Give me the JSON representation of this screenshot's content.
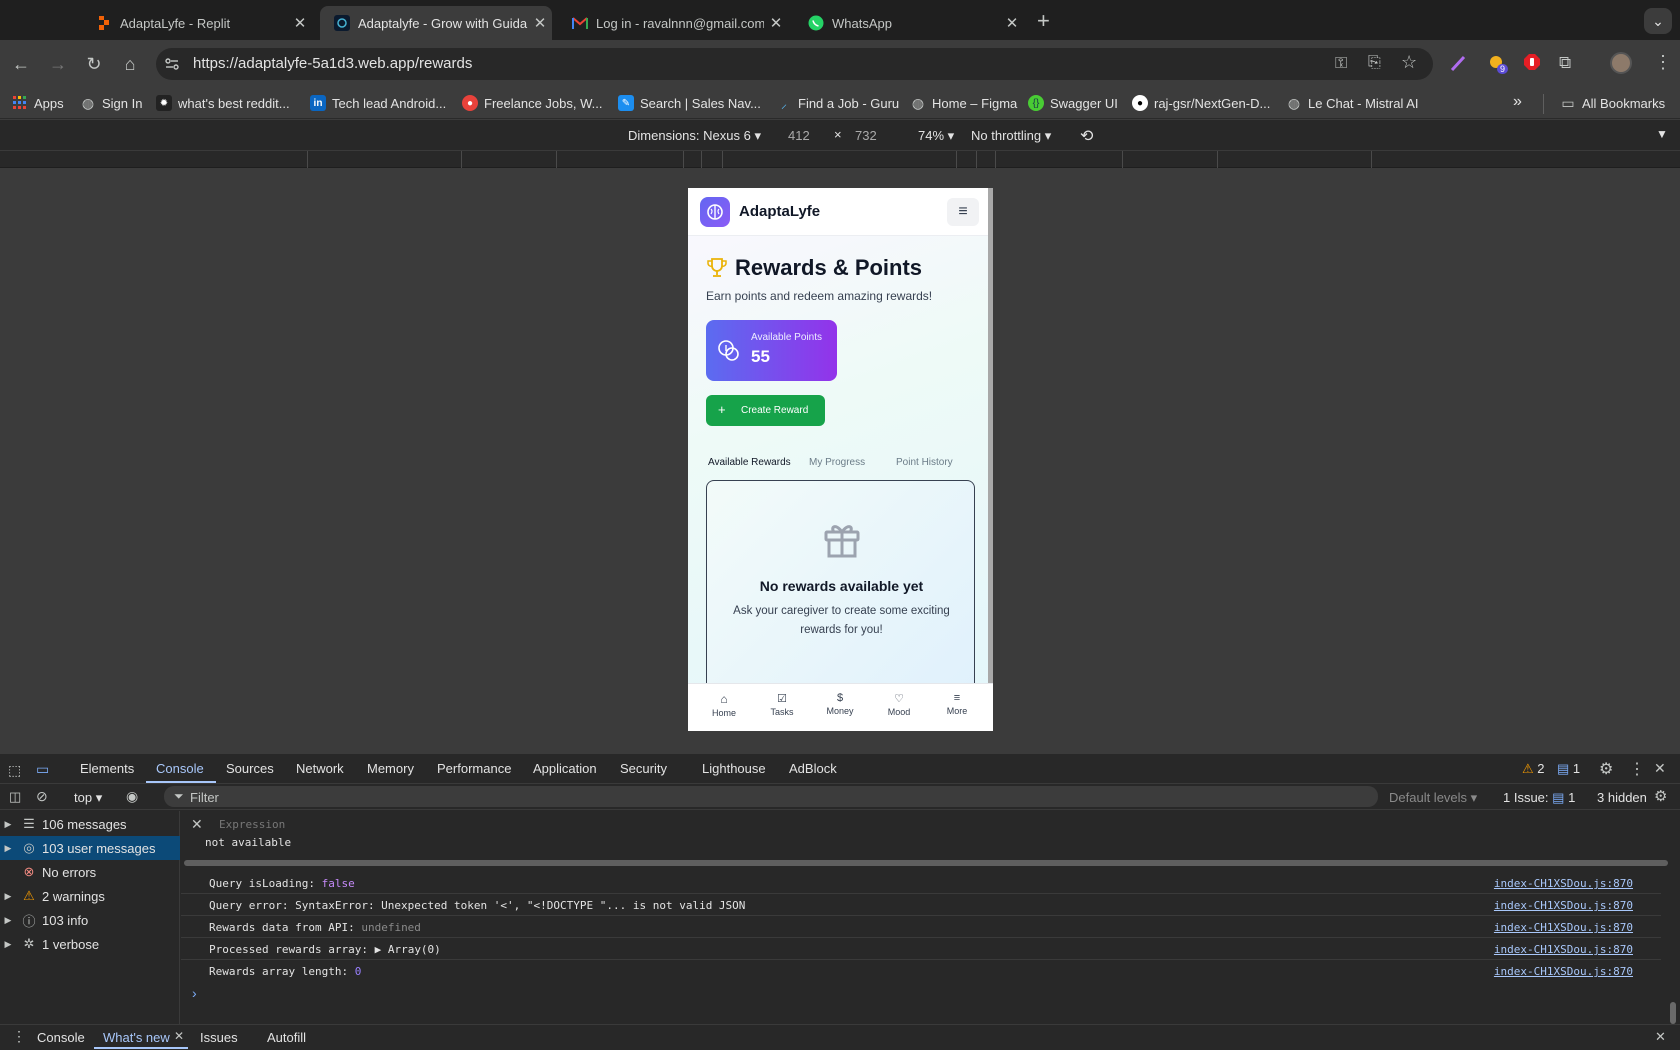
{
  "browser": {
    "tabs": [
      {
        "title": "AdaptaLyfe - Replit",
        "icon": "replit-icon",
        "active": false
      },
      {
        "title": "Adaptalyfe - Grow with Guida",
        "icon": "adaptalyfe-favicon-icon",
        "active": true
      },
      {
        "title": "Log in - ravalnnn@gmail.com",
        "icon": "gmail-icon",
        "active": false
      },
      {
        "title": "WhatsApp",
        "icon": "whatsapp-icon",
        "active": false
      }
    ],
    "new_tab_label": "+",
    "url": "https://adaptalyfe-5a1d3.web.app/rewards",
    "extension_badge": "9",
    "bookmarks": [
      {
        "label": "Apps",
        "icon": "apps-grid-icon"
      },
      {
        "label": "Sign In",
        "icon": "globe-icon"
      },
      {
        "label": "what's best reddit...",
        "icon": "reddit-icon"
      },
      {
        "label": "Tech lead Android...",
        "icon": "linkedin-icon"
      },
      {
        "label": "Freelance Jobs, W...",
        "icon": "upwork-icon"
      },
      {
        "label": "Search | Sales Nav...",
        "icon": "compass-icon"
      },
      {
        "label": "Find a Job - Guru",
        "icon": "guru-icon"
      },
      {
        "label": "Home – Figma",
        "icon": "globe-icon"
      },
      {
        "label": "Swagger UI",
        "icon": "swagger-icon"
      },
      {
        "label": "raj-gsr/NextGen-D...",
        "icon": "github-icon"
      },
      {
        "label": "Le Chat - Mistral AI",
        "icon": "globe-icon"
      }
    ],
    "all_bookmarks_label": "All Bookmarks",
    "more_bookmarks_label": "»"
  },
  "device_toolbar": {
    "dimensions_label": "Dimensions: Nexus 6",
    "width": "412",
    "height": "732",
    "times": "×",
    "zoom": "74%",
    "throttling": "No throttling"
  },
  "app": {
    "name": "AdaptaLyfe",
    "page_title": "Rewards & Points",
    "subtitle": "Earn points and redeem amazing rewards!",
    "points_label": "Available Points",
    "points_value": "55",
    "create_button": "Create Reward",
    "tabs": [
      "Available Rewards",
      "My Progress",
      "Point History"
    ],
    "empty_title": "No rewards available yet",
    "empty_text": "Ask your caregiver to create some exciting rewards for you!",
    "bottom_nav": [
      {
        "label": "Home",
        "icon": "home-icon"
      },
      {
        "label": "Tasks",
        "icon": "checkbox-icon"
      },
      {
        "label": "Money",
        "icon": "dollar-icon"
      },
      {
        "label": "Mood",
        "icon": "heart-icon"
      },
      {
        "label": "More",
        "icon": "menu-icon"
      }
    ],
    "colors": {
      "primary": "#6366f1",
      "accent_purple": "#9333ea",
      "green": "#16a34a"
    }
  },
  "devtools": {
    "tabs": [
      "Elements",
      "Console",
      "Sources",
      "Network",
      "Memory",
      "Performance",
      "Application",
      "Security",
      "Lighthouse",
      "AdBlock"
    ],
    "active_tab": "Console",
    "warnings_count": "2",
    "messages_count": "1",
    "context": "top",
    "filter_placeholder": "Filter",
    "levels": "Default levels",
    "issues_label": "1 Issue:",
    "issues_count": "1",
    "hidden_label": "3 hidden",
    "sidebar": [
      {
        "label": "106 messages",
        "icon": "list-icon"
      },
      {
        "label": "103 user messages",
        "icon": "user-icon"
      },
      {
        "label": "No errors",
        "icon": "error-icon"
      },
      {
        "label": "2 warnings",
        "icon": "warning-icon"
      },
      {
        "label": "103 info",
        "icon": "info-icon"
      },
      {
        "label": "1 verbose",
        "icon": "bug-icon"
      }
    ],
    "expression_placeholder": "Expression",
    "expression_value": "not available",
    "logs": [
      {
        "text": "Query isLoading: ",
        "value": "false",
        "source": "index-CH1XSDou.js:870"
      },
      {
        "text": "Query error: SyntaxError: Unexpected token '<', \"<!DOCTYPE \"... is not valid JSON",
        "value": "",
        "source": "index-CH1XSDou.js:870"
      },
      {
        "text": "Rewards data from API: ",
        "value": "undefined",
        "source": "index-CH1XSDou.js:870"
      },
      {
        "text": "Processed rewards array: ",
        "value": "▶ Array(0)",
        "source": "index-CH1XSDou.js:870"
      },
      {
        "text": "Rewards array length: ",
        "value": "0",
        "source": "index-CH1XSDou.js:870"
      }
    ],
    "prompt": "›",
    "bottom_tabs": [
      "Console",
      "What's new",
      "Issues",
      "Autofill"
    ]
  }
}
